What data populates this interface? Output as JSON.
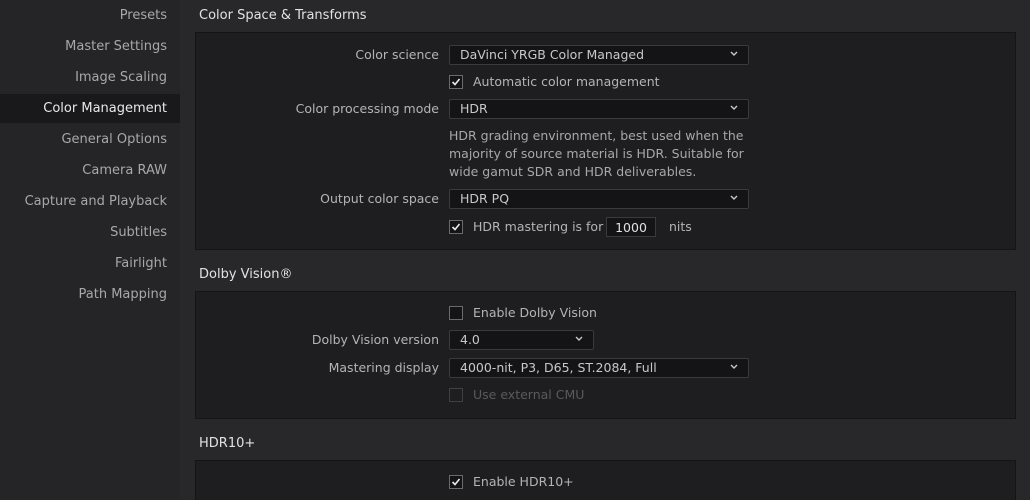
{
  "sidebar": {
    "items": [
      {
        "label": "Presets"
      },
      {
        "label": "Master Settings"
      },
      {
        "label": "Image Scaling"
      },
      {
        "label": "Color Management"
      },
      {
        "label": "General Options"
      },
      {
        "label": "Camera RAW"
      },
      {
        "label": "Capture and Playback"
      },
      {
        "label": "Subtitles"
      },
      {
        "label": "Fairlight"
      },
      {
        "label": "Path Mapping"
      }
    ],
    "active": "Color Management"
  },
  "color_space": {
    "title": "Color Space & Transforms",
    "color_science_label": "Color science",
    "color_science_value": "DaVinci YRGB Color Managed",
    "auto_cm_label": "Automatic color management",
    "auto_cm_checked": true,
    "processing_mode_label": "Color processing mode",
    "processing_mode_value": "HDR",
    "description_lines": [
      "HDR grading environment, best used when the",
      "majority of source material is HDR. Suitable for",
      "wide gamut SDR and HDR deliverables."
    ],
    "output_space_label": "Output color space",
    "output_space_value": "HDR PQ",
    "hdr_mastering_label": "HDR mastering is for",
    "hdr_mastering_checked": true,
    "hdr_mastering_nits": "1000",
    "nits_unit": "nits"
  },
  "dolby_vision": {
    "title": "Dolby Vision®",
    "enable_label": "Enable Dolby Vision",
    "enable_checked": false,
    "version_label": "Dolby Vision version",
    "version_value": "4.0",
    "mastering_display_label": "Mastering display",
    "mastering_display_value": "4000-nit, P3, D65, ST.2084, Full",
    "external_cmu_label": "Use external CMU",
    "external_cmu_checked": false
  },
  "hdr10plus": {
    "title": "HDR10+",
    "enable_label": "Enable HDR10+",
    "enable_checked": true
  },
  "colors": {
    "background": "#28282a",
    "panel": "#1e1e20",
    "sidebar_active": "#19191b",
    "input_bg": "#141416",
    "text": "#c8c8c8"
  }
}
